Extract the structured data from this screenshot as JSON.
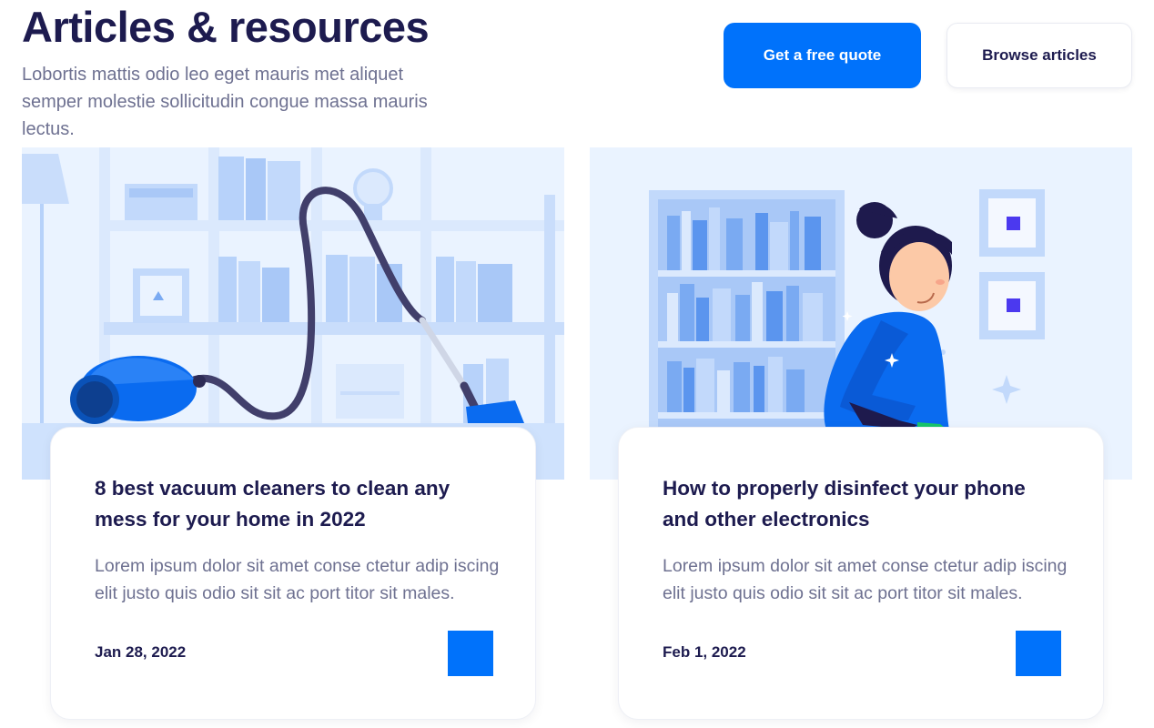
{
  "header": {
    "title": "Articles & resources",
    "subtitle": "Lobortis mattis odio leo eget mauris met aliquet semper molestie sollicitudin congue massa mauris lectus.",
    "primary_button": "Get a free quote",
    "secondary_button": "Browse articles"
  },
  "articles": [
    {
      "title": "8 best vacuum cleaners to clean any mess for your home in 2022",
      "excerpt": "Lorem ipsum dolor sit amet conse ctetur adip iscing elit justo quis odio sit sit ac port titor sit males.",
      "date": "Jan 28, 2022",
      "illustration": "vacuum-cleaner-illustration"
    },
    {
      "title": "How to properly disinfect your phone and other electronics",
      "excerpt": "Lorem ipsum dolor sit amet conse ctetur adip iscing elit justo quis odio sit sit ac port titor sit males.",
      "date": "Feb 1, 2022",
      "illustration": "woman-cleaning-illustration"
    }
  ],
  "colors": {
    "accent": "#0072fb",
    "heading": "#1d1b4f",
    "body_text": "#6e7191",
    "image_bg": "#eaf3ff"
  }
}
